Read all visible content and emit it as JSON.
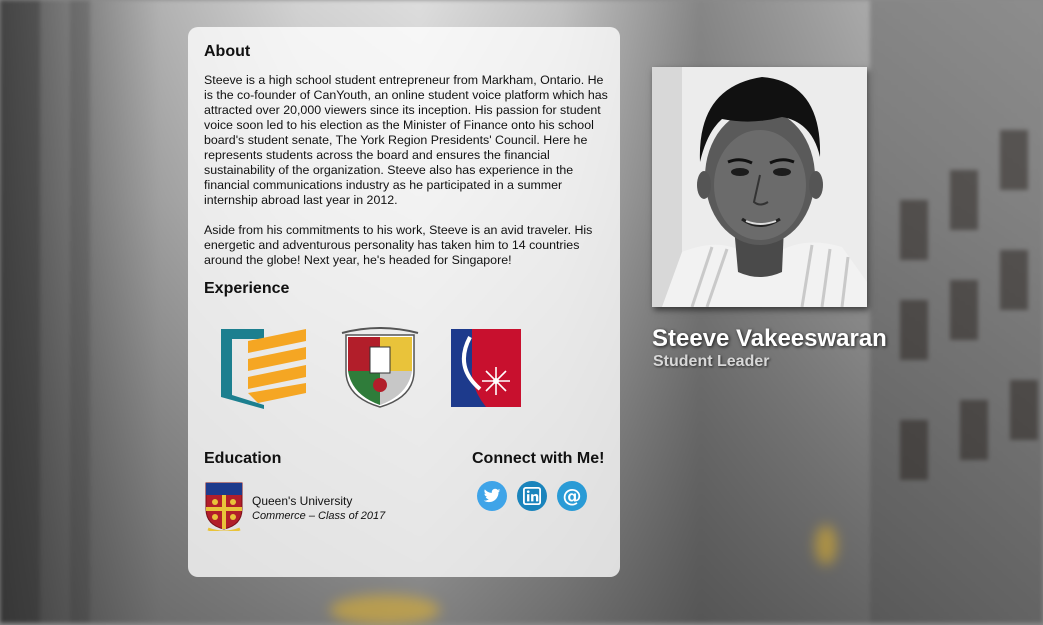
{
  "about": {
    "heading": "About",
    "paragraph1": "Steeve is a high school student entrepreneur from Markham, Ontario. He is the co-founder of CanYouth, an online student voice platform which has attracted over 20,000 viewers since its inception. His passion for student voice soon led to his election as the Minister of Finance onto his school board's student senate, The York Region Presidents' Council. Here he represents students across the board and ensures the financial sustainability of the organization. Steeve also has experience in the financial communications industry as he participated in a summer internship abroad last year in 2012.",
    "paragraph2": "Aside from his commitments to his work, Steeve is an avid traveler. His energetic and adventurous personality has taken him to 14 countries around the globe! Next year, he's headed for Singapore!"
  },
  "experience": {
    "heading": "Experience",
    "logos": [
      {
        "icon": "canyouth-logo-icon"
      },
      {
        "icon": "school-crest-icon"
      },
      {
        "icon": "internship-logo-icon"
      }
    ]
  },
  "education": {
    "heading": "Education",
    "school": "Queen's University",
    "detail": "Commerce – Class of 2017",
    "icon": "queens-crest-icon"
  },
  "connect": {
    "heading": "Connect with Me!",
    "links": [
      {
        "icon": "twitter-icon",
        "color": "#3fa4e8"
      },
      {
        "icon": "linkedin-icon",
        "color": "#1a84bc"
      },
      {
        "icon": "email-icon",
        "color": "#2a9bd6"
      }
    ]
  },
  "profile": {
    "name": "Steeve Vakeeswaran",
    "role": "Student Leader"
  },
  "colors": {
    "card_bg": "#ffffffc7",
    "canyouth_teal": "#1c7f8f",
    "canyouth_orange": "#f5a623",
    "internship_blue": "#1d3a8c",
    "internship_red": "#c8102e"
  }
}
